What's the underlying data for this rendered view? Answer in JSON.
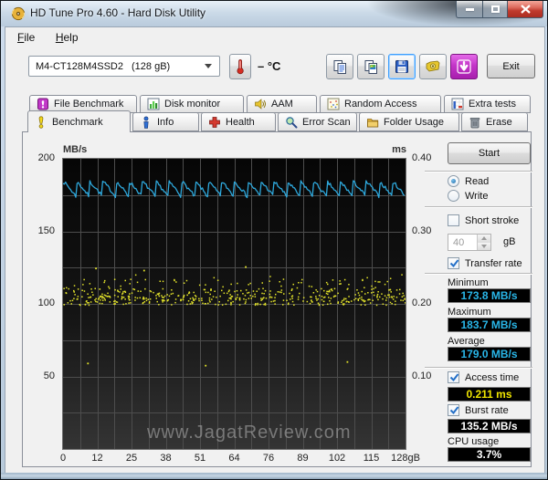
{
  "window": {
    "title": "HD Tune Pro 4.60 - Hard Disk Utility"
  },
  "menu": {
    "items": [
      "File",
      "Help"
    ]
  },
  "toolbar": {
    "drive_model": "M4-CT128M4SSD2",
    "drive_capacity": "(128 gB)",
    "temperature": "– °C",
    "icon_buttons": [
      "copy-text",
      "copy-image",
      "save",
      "screenshot",
      "update"
    ],
    "exit_label": "Exit"
  },
  "tabs": {
    "row1": [
      {
        "label": "File Benchmark"
      },
      {
        "label": "Disk monitor"
      },
      {
        "label": "AAM"
      },
      {
        "label": "Random Access"
      },
      {
        "label": "Extra tests"
      }
    ],
    "row2": [
      {
        "label": "Benchmark",
        "active": true
      },
      {
        "label": "Info"
      },
      {
        "label": "Health"
      },
      {
        "label": "Error Scan"
      },
      {
        "label": "Folder Usage"
      },
      {
        "label": "Erase"
      }
    ]
  },
  "panel": {
    "start_button": "Start",
    "mode": {
      "options": [
        "Read",
        "Write"
      ],
      "selected": "Read"
    },
    "short_stroke": {
      "label": "Short stroke",
      "checked": false,
      "value": "40",
      "unit": "gB"
    },
    "transfer_rate": {
      "label": "Transfer rate",
      "checked": true
    },
    "minimum": {
      "label": "Minimum",
      "value": "173.8 MB/s"
    },
    "maximum": {
      "label": "Maximum",
      "value": "183.7 MB/s"
    },
    "average": {
      "label": "Average",
      "value": "179.0 MB/s"
    },
    "access_time": {
      "label": "Access time",
      "checked": true,
      "value": "0.211 ms"
    },
    "burst_rate": {
      "label": "Burst rate",
      "checked": true,
      "value": "135.2 MB/s"
    },
    "cpu_usage": {
      "label": "CPU usage",
      "value": "3.7%"
    }
  },
  "colors": {
    "transfer_line": "#2ea8dc",
    "access_dots": "#e3e32a",
    "grid": "#4d4d4d",
    "value_cyan": "#29b6e8",
    "value_yellow": "#efe400"
  },
  "chart_data": {
    "type": "line+scatter",
    "title": "HD Tune Pro read benchmark - M4-CT128M4SSD2 128 gB",
    "x_axis": {
      "unit": "gB",
      "min": 0,
      "max": 128,
      "tick_labels": [
        "0",
        "12",
        "25",
        "38",
        "51",
        "64",
        "76",
        "89",
        "102",
        "115",
        "128gB"
      ],
      "tick_values": [
        0,
        12.8,
        25.6,
        38.4,
        51.2,
        64,
        76.8,
        89.6,
        102.4,
        115.2,
        128
      ],
      "grid_divisions": 20
    },
    "y_left_axis": {
      "label": "MB/s",
      "min": 0,
      "max": 200,
      "tick_values": [
        200,
        150,
        100,
        50
      ],
      "grid_step": 25
    },
    "y_right_axis": {
      "label": "ms",
      "min": 0,
      "max": 0.4,
      "tick_values": [
        0.4,
        0.3,
        0.2,
        0.1
      ],
      "tick_labels": [
        "0.40",
        "0.30",
        "0.20",
        "0.10"
      ]
    },
    "series": [
      {
        "name": "Transfer rate",
        "type": "line",
        "unit": "MB/s",
        "color": "#2ea8dc",
        "shape": "sawtooth",
        "teeth": 26,
        "seed": 7,
        "min": 173.8,
        "max": 183.7,
        "avg": 179.0
      },
      {
        "name": "Access time",
        "type": "scatter",
        "unit": "ms",
        "color": "#e3e32a",
        "measured": 0.211,
        "points": 520,
        "seed": 13,
        "dense_band_ms": [
          0.199,
          0.212
        ],
        "spread_band_ms": [
          0.205,
          0.242
        ],
        "outliers_x_gb_y_ms": [
          [
            9,
            0.119
          ],
          [
            53,
            0.116
          ],
          [
            106,
            0.121
          ],
          [
            12,
            0.25
          ],
          [
            30,
            0.247
          ],
          [
            68,
            0.252
          ]
        ]
      }
    ],
    "grid_on": true,
    "watermark": "www.JagatReview.com"
  }
}
